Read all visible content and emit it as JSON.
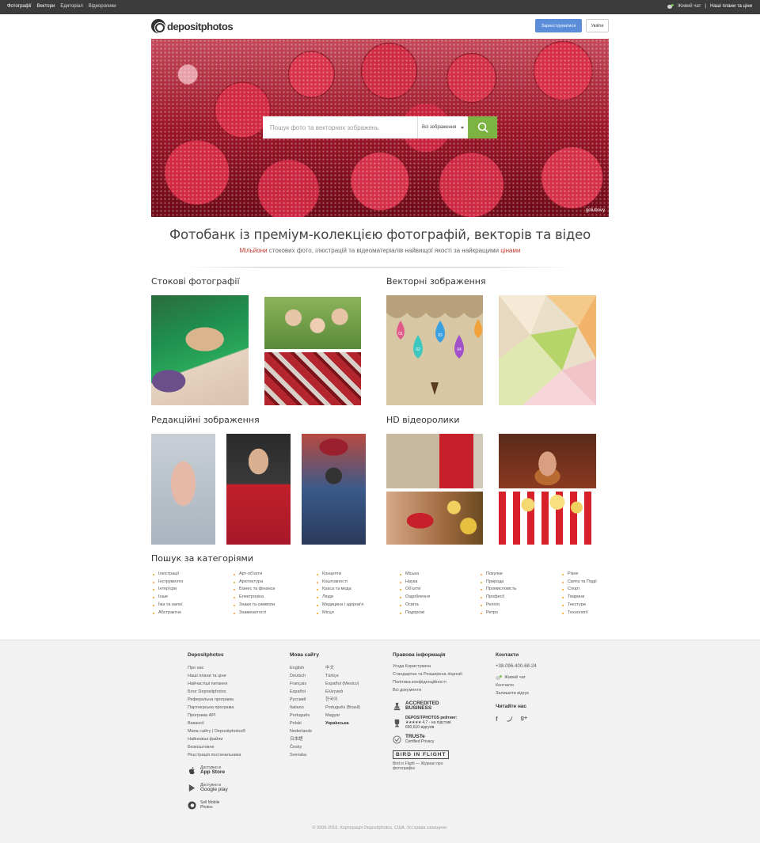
{
  "topbar": {
    "nav": [
      "Фотографії",
      "Вектори",
      "Едиторіал",
      "Відеоролики"
    ],
    "live_chat": "Живий чат",
    "plans": "Наші плани та ціни"
  },
  "header": {
    "logo": "depositphotos",
    "register": "Зареєструватися",
    "login": "Увійти"
  },
  "hero": {
    "search_placeholder": "Пошук фото та векторних зображень",
    "search_scope": "Всі зображення",
    "credit": "golubovy"
  },
  "headline": "Фотобанк із преміум-колекцією фотографій, векторів та відео",
  "subline_parts": [
    "Мільйони",
    "стокових фото, ілюстрацій та відеоматеріалів найвищої якості за найкращими",
    "цінами"
  ],
  "sections": {
    "stock": "Стокові фотографії",
    "vector": "Векторні зображення",
    "editorial": "Редакційні зображення",
    "video": "HD відеоролики",
    "categories": "Пошук за категоріями"
  },
  "vector_drops": [
    "01",
    "02",
    "03",
    "04"
  ],
  "categories": [
    [
      "Ілюстрації",
      "Інструменти",
      "Інтер'єри",
      "Інше",
      "Їжа та напої",
      "Абстрактне"
    ],
    [
      "Арт-об'єкти",
      "Архітектура",
      "Бізнес та фінанси",
      "Електроніка",
      "Знаки та символи",
      "Знаменитості"
    ],
    [
      "Концепти",
      "Коштовності",
      "Краса та мода",
      "Люди",
      "Медицина і здоров'я",
      "Місця"
    ],
    [
      "Міська",
      "Наука",
      "Об'єкти",
      "Оздоблення",
      "Освіта",
      "Подорожі"
    ],
    [
      "Покупки",
      "Природа",
      "Промисловість",
      "Професії",
      "Релігія",
      "Ретро"
    ],
    [
      "Різне",
      "Свята та Події",
      "Спорт",
      "Тварини",
      "Текстури",
      "Технології"
    ]
  ],
  "footer": {
    "company": {
      "title": "Depositphotos",
      "links": [
        "Про нас",
        "Наші плани та ціни",
        "Найчастіші питання",
        "Блог Depositphotos",
        "Реферальна програма",
        "Партнерська програма",
        "Програма API",
        "Вакансії",
        "Мапа сайту | Depositphotos®",
        "Найновіші файли",
        "Безкоштовне",
        "Реєстрація постачальника"
      ]
    },
    "apps": [
      {
        "line1": "Доступно в",
        "line2": "App Store"
      },
      {
        "line1": "Доступно в",
        "line2": "Google play"
      },
      {
        "line1": "Sell Mobile",
        "line2": "Photos"
      }
    ],
    "languages": {
      "title": "Мова сайту",
      "col1": [
        "English",
        "Deutsch",
        "Français",
        "Español",
        "Русский",
        "Italiano",
        "Português",
        "Polski",
        "Nederlands",
        "日本語",
        "Česky",
        "Svenska"
      ],
      "col2": [
        "中文",
        "Türkçe",
        "Español (Mexico)",
        "Ελληνικά",
        "한국어",
        "Português (Brasil)",
        "Magyar",
        "Українська"
      ]
    },
    "legal": {
      "title": "Правова інформація",
      "links": [
        "Угода Користувача",
        "Стандартна та Розширена ліцензії",
        "Політика конфіденційності",
        "Всі документи"
      ],
      "bbb": [
        "ACCREDITED",
        "BUSINESS"
      ],
      "rating_title": "DEPOSITPHOTOS рейтинг:",
      "rating_value": "4.7 - на підставі",
      "rating_count": "690,610 відгуків",
      "truste": [
        "TRUSTe",
        "Certified Privacy"
      ],
      "bif_logo": "BIRD IN FLIGHT",
      "bif_text": "Bird in Flight — Журнал про фотографію"
    },
    "contacts": {
      "title": "Контакти",
      "phone": "+38-096-400-68-24",
      "chat": "Живий чат",
      "contacts_link": "Контакти",
      "feedback": "Залишити відгук",
      "follow_title": "Читайте нас",
      "social": [
        "f",
        "t",
        "g+"
      ]
    },
    "copyright": "© 2009-2015. Корпорація Depositphotos, США. Усі права захищено."
  },
  "colors": {
    "topbar": "#3b3b3b",
    "register_button": "#5b8dd9",
    "search_button": "#7cb342",
    "bullet": "#f0a020",
    "footer_bg": "#f2f2f2"
  }
}
